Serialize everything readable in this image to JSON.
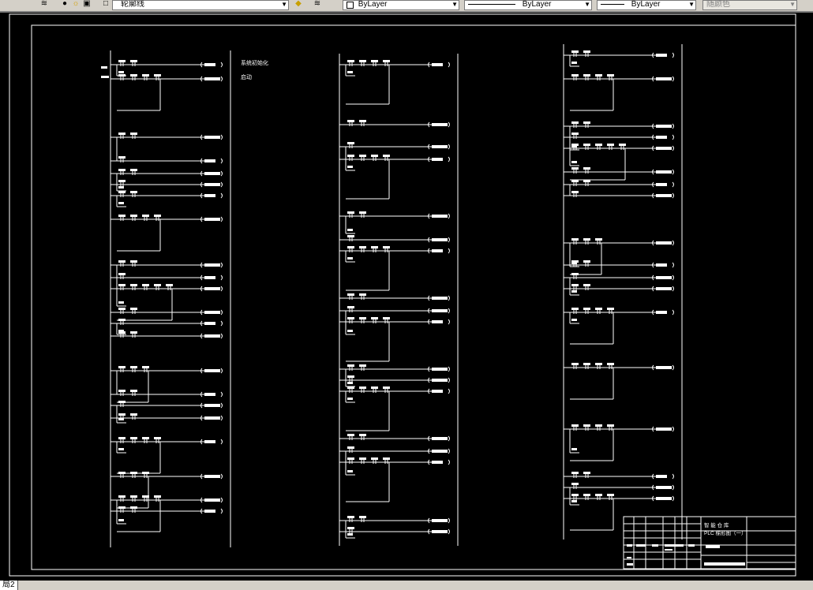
{
  "toolbar": {
    "layer_name": "轮廓线",
    "color": "ByLayer",
    "linetype": "ByLayer",
    "lineweight": "ByLayer",
    "plotstyle": "随颜色"
  },
  "drawing": {
    "annotation_init": "系统初始化",
    "annotation_start": "启动",
    "title_block_line1": "智 能 仓 库",
    "title_block_line2": "PLC 梯形图（一）"
  },
  "status": {
    "layout_tab": "局2"
  }
}
